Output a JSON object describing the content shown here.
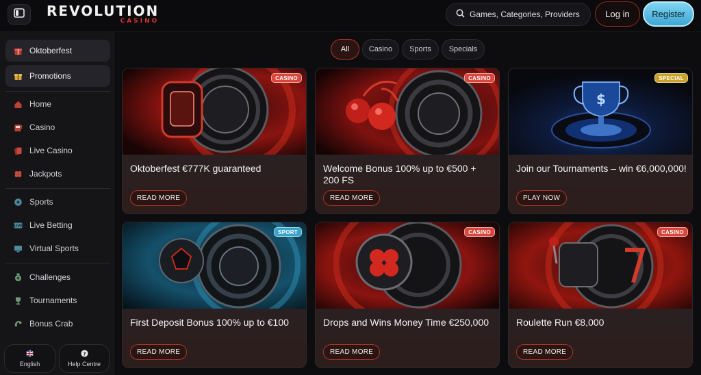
{
  "header": {
    "logo_main": "REVOLUTION",
    "logo_sub": "CASINO",
    "search_placeholder": "Games, Categories, Providers",
    "login_label": "Log in",
    "register_label": "Register"
  },
  "sidebar": {
    "featured": [
      {
        "label": "Oktoberfest",
        "icon": "gift-box-icon"
      },
      {
        "label": "Promotions",
        "icon": "gift-icon"
      }
    ],
    "group1": [
      {
        "label": "Home",
        "icon": "home-icon"
      },
      {
        "label": "Casino",
        "icon": "slot-machine-icon"
      },
      {
        "label": "Live Casino",
        "icon": "cards-icon"
      },
      {
        "label": "Jackpots",
        "icon": "clover-icon"
      }
    ],
    "group2": [
      {
        "label": "Sports",
        "icon": "ball-icon"
      },
      {
        "label": "Live Betting",
        "icon": "live-icon"
      },
      {
        "label": "Virtual Sports",
        "icon": "monitor-icon"
      }
    ],
    "group3": [
      {
        "label": "Challenges",
        "icon": "medal-icon"
      },
      {
        "label": "Tournaments",
        "icon": "trophy-icon"
      },
      {
        "label": "Bonus Crab",
        "icon": "crab-claw-icon"
      }
    ],
    "footer": {
      "language_label": "English",
      "help_label": "Help Centre"
    }
  },
  "filters": [
    {
      "label": "All",
      "active": true
    },
    {
      "label": "Casino",
      "active": false
    },
    {
      "label": "Sports",
      "active": false
    },
    {
      "label": "Specials",
      "active": false
    }
  ],
  "promotions": [
    {
      "badge": "CASINO",
      "title": "Oktoberfest €777K guaranteed",
      "button": "READ MORE"
    },
    {
      "badge": "CASINO",
      "title": "Welcome Bonus 100% up to €500 + 200 FS",
      "button": "READ MORE"
    },
    {
      "badge": "SPECIAL",
      "title": "Join our Tournaments – win €6,000,000!",
      "button": "PLAY NOW"
    },
    {
      "badge": "SPORT",
      "title": "First Deposit Bonus 100% up to €100",
      "button": "READ MORE"
    },
    {
      "badge": "CASINO",
      "title": "Drops and Wins Money Time €250,000",
      "button": "READ MORE"
    },
    {
      "badge": "CASINO",
      "title": "Roulette Run €8,000",
      "button": "READ MORE"
    }
  ],
  "colors": {
    "accent_red": "#c0392b",
    "register_blue": "#54b8e0",
    "badge_casino": "#d9463a",
    "badge_special": "#c9a227",
    "badge_sport": "#3aa3c9"
  }
}
